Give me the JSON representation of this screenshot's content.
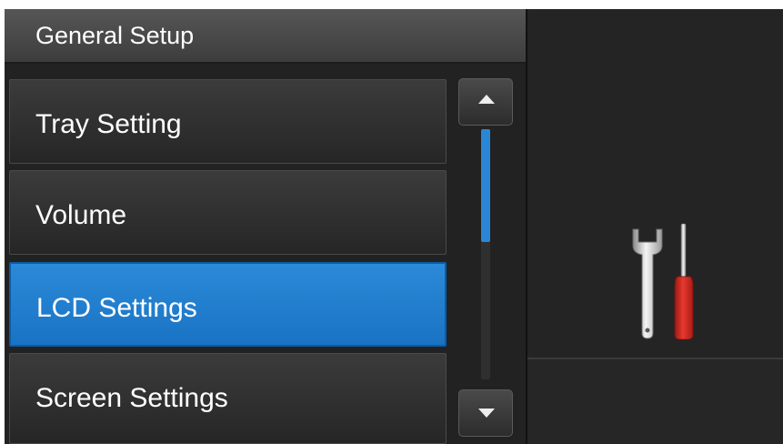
{
  "header": {
    "title": "General Setup"
  },
  "menu": {
    "items": [
      {
        "label": "Tray Setting",
        "selected": false
      },
      {
        "label": "Volume",
        "selected": false
      },
      {
        "label": "LCD Settings",
        "selected": true
      },
      {
        "label": "Screen Settings",
        "selected": false
      }
    ]
  },
  "scrollbar": {
    "position_fraction": 0.0,
    "visible_fraction": 0.45,
    "up_icon": "triangle-up-icon",
    "down_icon": "triangle-down-icon"
  },
  "side_panel": {
    "icon": "wrench-screwdriver-icon"
  },
  "colors": {
    "accent": "#1a7bcf",
    "screwdriver_handle": "#d8281f"
  }
}
